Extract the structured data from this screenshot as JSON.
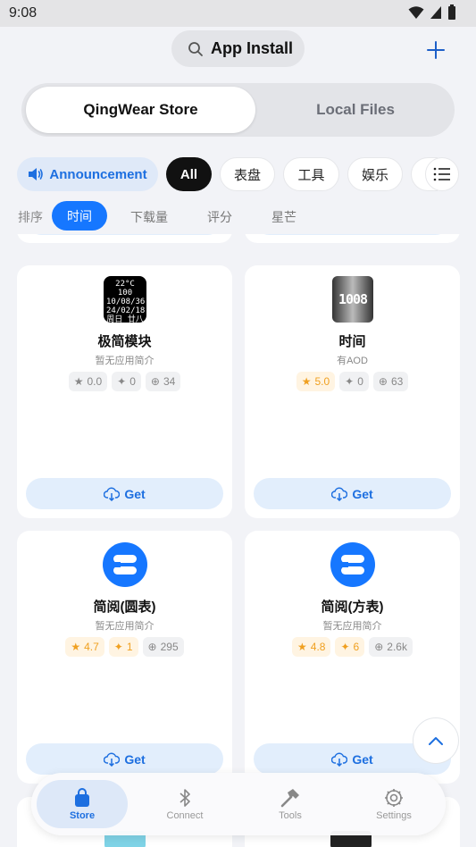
{
  "status_bar": {
    "time": "9:08"
  },
  "header": {
    "title": "App Install"
  },
  "segments": {
    "store": "QingWear Store",
    "local": "Local Files"
  },
  "categories": {
    "announcement": "Announcement",
    "all": "All",
    "items": [
      "表盘",
      "工具",
      "娱乐"
    ]
  },
  "sort": {
    "label": "排序",
    "options": [
      "时间",
      "下载量",
      "评分",
      "星芒"
    ],
    "active": "时间"
  },
  "apps": [
    {
      "name": "极简模块",
      "desc": "暂无应用简介",
      "rating": "0.0",
      "sparks": "0",
      "downloads": "34",
      "get": "Get",
      "face_lines": [
        "22°C 100",
        "10/08/36",
        "24/02/18",
        "周日 廿八"
      ]
    },
    {
      "name": "时间",
      "desc": "有AOD",
      "rating": "5.0",
      "sparks": "0",
      "downloads": "63",
      "get": "Get",
      "face_digits": "1008"
    },
    {
      "name": "简阅(圆表)",
      "desc": "暂无应用简介",
      "rating": "4.7",
      "sparks": "1",
      "downloads": "295",
      "get": "Get"
    },
    {
      "name": "简阅(方表)",
      "desc": "暂无应用简介",
      "rating": "4.8",
      "sparks": "6",
      "downloads": "2.6k",
      "get": "Get"
    }
  ],
  "nav": {
    "store": "Store",
    "connect": "Connect",
    "tools": "Tools",
    "settings": "Settings"
  },
  "colors": {
    "accent": "#1677ff",
    "accent_text": "#1d6fe0",
    "star": "#f0a020",
    "background": "#f2f3f7"
  }
}
